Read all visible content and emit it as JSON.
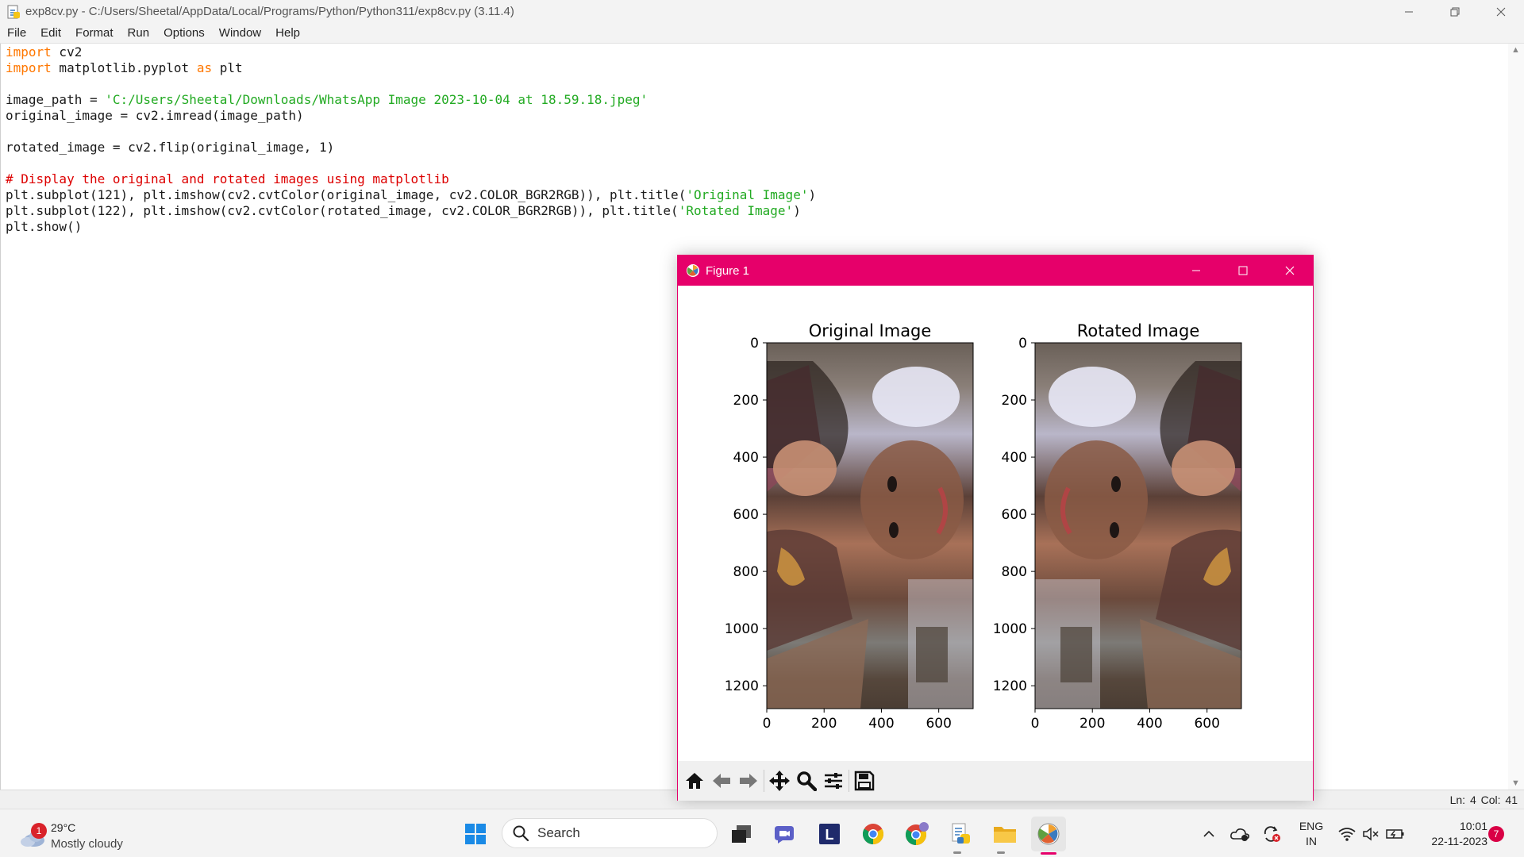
{
  "window": {
    "title": "exp8cv.py - C:/Users/Sheetal/AppData/Local/Programs/Python/Python311/exp8cv.py (3.11.4)"
  },
  "menu": [
    "File",
    "Edit",
    "Format",
    "Run",
    "Options",
    "Window",
    "Help"
  ],
  "code": {
    "lines": [
      [
        {
          "t": "import",
          "c": "kw"
        },
        {
          "t": " cv2",
          "c": ""
        }
      ],
      [
        {
          "t": "import",
          "c": "kw"
        },
        {
          "t": " matplotlib.pyplot ",
          "c": ""
        },
        {
          "t": "as",
          "c": "kw"
        },
        {
          "t": " plt",
          "c": ""
        }
      ],
      [],
      [
        {
          "t": "image_path = ",
          "c": ""
        },
        {
          "t": "'C:/Users/Sheetal/Downloads/WhatsApp Image 2023-10-04 at 18.59.18.jpeg'",
          "c": "str"
        }
      ],
      [
        {
          "t": "original_image = cv2.imread(image_path)",
          "c": ""
        }
      ],
      [],
      [
        {
          "t": "rotated_image = cv2.flip(original_image, 1)",
          "c": ""
        }
      ],
      [],
      [
        {
          "t": "# Display the original and rotated images using matplotlib",
          "c": "cmt"
        }
      ],
      [
        {
          "t": "plt.subplot(121), plt.imshow(cv2.cvtColor(original_image, cv2.COLOR_BGR2RGB)), plt.title(",
          "c": ""
        },
        {
          "t": "'Original Image'",
          "c": "str"
        },
        {
          "t": ")",
          "c": ""
        }
      ],
      [
        {
          "t": "plt.subplot(122), plt.imshow(cv2.cvtColor(rotated_image, cv2.COLOR_BGR2RGB)), plt.title(",
          "c": ""
        },
        {
          "t": "'Rotated Image'",
          "c": "str"
        },
        {
          "t": ")",
          "c": ""
        }
      ],
      [
        {
          "t": "plt.show()",
          "c": ""
        }
      ]
    ]
  },
  "status": {
    "position": "Ln: 4   Col: 41"
  },
  "figure": {
    "title": "Figure 1",
    "toolbar": [
      "home-icon",
      "back-arrow-icon",
      "forward-arrow-icon",
      "pan-icon",
      "zoom-icon",
      "configure-subplots-icon",
      "save-icon"
    ]
  },
  "chart_data": [
    {
      "type": "image",
      "title": "Original Image",
      "xticks": [
        0,
        200,
        400,
        600
      ],
      "yticks": [
        0,
        200,
        400,
        600,
        800,
        1000,
        1200
      ],
      "xlim": [
        0,
        720
      ],
      "ylim": [
        1280,
        0
      ]
    },
    {
      "type": "image",
      "title": "Rotated Image",
      "xticks": [
        0,
        200,
        400,
        600
      ],
      "yticks": [
        0,
        200,
        400,
        600,
        800,
        1000,
        1200
      ],
      "xlim": [
        0,
        720
      ],
      "ylim": [
        1280,
        0
      ]
    }
  ],
  "taskbar": {
    "weather": {
      "badge": "1",
      "temp": "29°C",
      "condition": "Mostly cloudy"
    },
    "search_label": "Search",
    "language": {
      "line1": "ENG",
      "line2": "IN"
    },
    "clock": {
      "time": "10:01",
      "date": "22-11-2023"
    },
    "notifications": "7"
  },
  "colors": {
    "figure_accent": "#e6006a",
    "keyword": "#ff7700",
    "string": "#22aa22",
    "comment": "#dd0000"
  }
}
